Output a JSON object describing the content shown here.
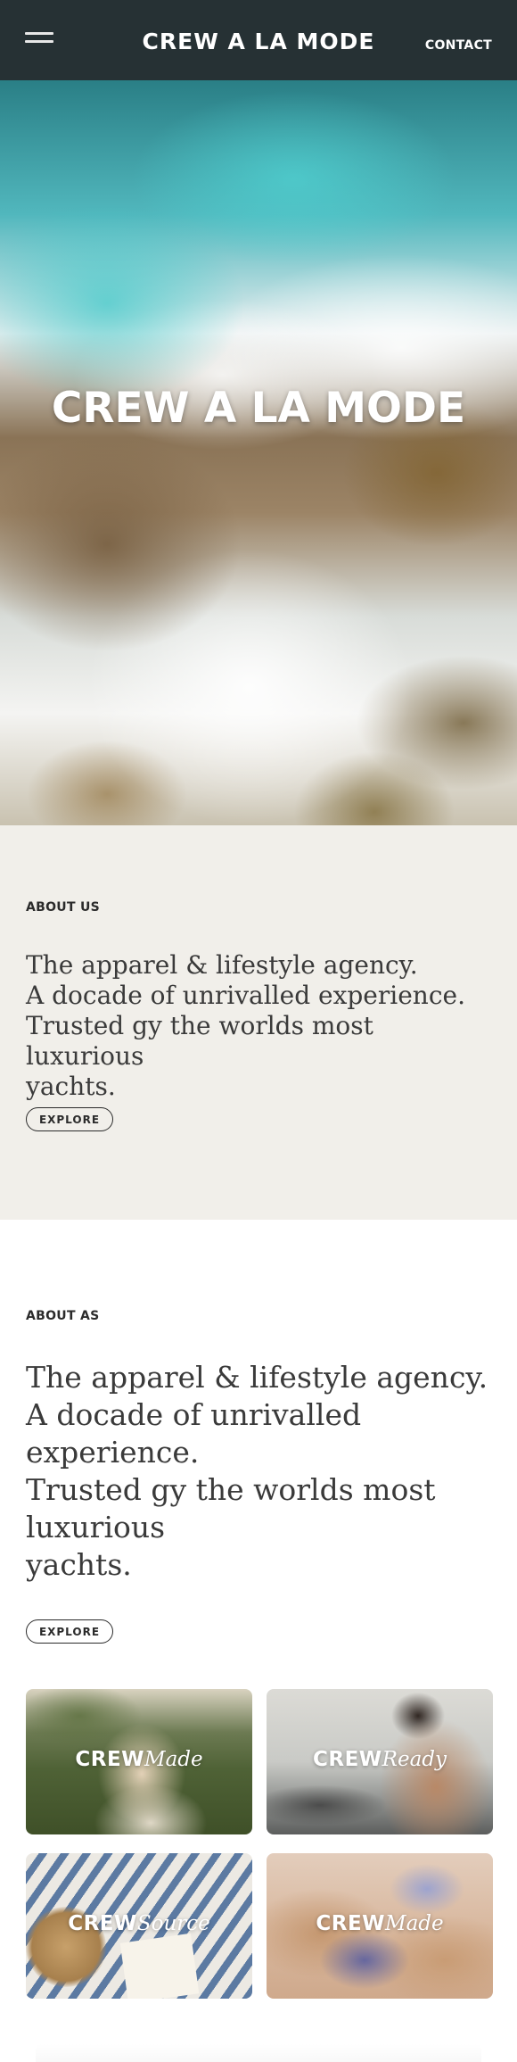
{
  "header": {
    "brand": "CREW A LA MODE",
    "contact_label": "CONTACT"
  },
  "hero": {
    "title": "CREW A LA MODE"
  },
  "about_primary": {
    "label": "ABOUT US",
    "lines": [
      "The apparel & lifestyle agency.",
      "A docade of unrivalled experience.",
      "Trusted gy the worlds most luxurious",
      "yachts."
    ],
    "button_label": "EXPLORE"
  },
  "about_secondary": {
    "label": "ABOUT AS",
    "lines": [
      "The apparel & lifestyle agency.",
      "A docade of unrivalled",
      "experience.",
      "Trusted gy the worlds most",
      "luxurious",
      "yachts."
    ],
    "button_label": "EXPLORE"
  },
  "cards": [
    {
      "brand": "CREW",
      "word": "Made"
    },
    {
      "brand": "CREW",
      "word": "Ready"
    },
    {
      "brand": "CREW",
      "word": "Source"
    },
    {
      "brand": "CREW",
      "word": "Made"
    }
  ],
  "colors": {
    "header_bg": "#263134",
    "about_bg": "#f1efea",
    "text_dark": "#2b2b2b"
  },
  "icons": {
    "menu": "hamburger-menu-icon"
  }
}
